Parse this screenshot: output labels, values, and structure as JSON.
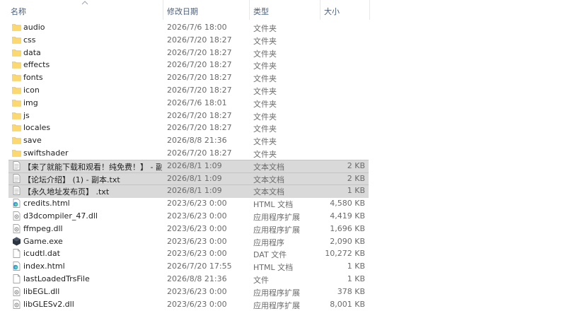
{
  "columns": {
    "name": "名称",
    "date": "修改日期",
    "type": "类型",
    "size": "大小"
  },
  "files": [
    {
      "name": "audio",
      "date": "2026/7/6 18:00",
      "type": "文件夹",
      "size": "",
      "icon": "folder-icon",
      "selected": false
    },
    {
      "name": "css",
      "date": "2026/7/20 18:27",
      "type": "文件夹",
      "size": "",
      "icon": "folder-icon",
      "selected": false
    },
    {
      "name": "data",
      "date": "2026/7/20 18:27",
      "type": "文件夹",
      "size": "",
      "icon": "folder-icon",
      "selected": false
    },
    {
      "name": "effects",
      "date": "2026/7/20 18:27",
      "type": "文件夹",
      "size": "",
      "icon": "folder-icon",
      "selected": false
    },
    {
      "name": "fonts",
      "date": "2026/7/20 18:27",
      "type": "文件夹",
      "size": "",
      "icon": "folder-icon",
      "selected": false
    },
    {
      "name": "icon",
      "date": "2026/7/20 18:27",
      "type": "文件夹",
      "size": "",
      "icon": "folder-icon",
      "selected": false
    },
    {
      "name": "img",
      "date": "2026/7/6 18:01",
      "type": "文件夹",
      "size": "",
      "icon": "folder-icon",
      "selected": false
    },
    {
      "name": "js",
      "date": "2026/7/20 18:27",
      "type": "文件夹",
      "size": "",
      "icon": "folder-icon",
      "selected": false
    },
    {
      "name": "locales",
      "date": "2026/7/20 18:27",
      "type": "文件夹",
      "size": "",
      "icon": "folder-icon",
      "selected": false
    },
    {
      "name": "save",
      "date": "2026/8/8 21:36",
      "type": "文件夹",
      "size": "",
      "icon": "folder-icon",
      "selected": false
    },
    {
      "name": "swiftshader",
      "date": "2026/7/20 18:27",
      "type": "文件夹",
      "size": "",
      "icon": "folder-icon",
      "selected": false
    },
    {
      "name": "【来了就能下载和观看！纯免费！】 - 副...",
      "date": "2026/8/1 1:09",
      "type": "文本文档",
      "size": "2 KB",
      "icon": "text-file-icon",
      "selected": true
    },
    {
      "name": "【论坛介绍】 (1) - 副本.txt",
      "date": "2026/8/1 1:09",
      "type": "文本文档",
      "size": "2 KB",
      "icon": "text-file-icon",
      "selected": true
    },
    {
      "name": "【永久地址发布页】 .txt",
      "date": "2026/8/1 1:09",
      "type": "文本文档",
      "size": "1 KB",
      "icon": "text-file-icon",
      "selected": true
    },
    {
      "name": "credits.html",
      "date": "2023/6/23 0:00",
      "type": "HTML 文档",
      "size": "4,580 KB",
      "icon": "edge-html-icon",
      "selected": false
    },
    {
      "name": "d3dcompiler_47.dll",
      "date": "2023/6/23 0:00",
      "type": "应用程序扩展",
      "size": "4,419 KB",
      "icon": "dll-file-icon",
      "selected": false
    },
    {
      "name": "ffmpeg.dll",
      "date": "2023/6/23 0:00",
      "type": "应用程序扩展",
      "size": "1,696 KB",
      "icon": "dll-file-icon",
      "selected": false
    },
    {
      "name": "Game.exe",
      "date": "2023/6/23 0:00",
      "type": "应用程序",
      "size": "2,090 KB",
      "icon": "game-exe-icon",
      "selected": false
    },
    {
      "name": "icudtl.dat",
      "date": "2023/6/23 0:00",
      "type": "DAT 文件",
      "size": "10,272 KB",
      "icon": "blank-file-icon",
      "selected": false
    },
    {
      "name": "index.html",
      "date": "2026/7/20 17:55",
      "type": "HTML 文档",
      "size": "1 KB",
      "icon": "edge-html-icon",
      "selected": false
    },
    {
      "name": "lastLoadedTrsFile",
      "date": "2026/8/8 21:36",
      "type": "文件",
      "size": "1 KB",
      "icon": "blank-file-icon",
      "selected": false
    },
    {
      "name": "libEGL.dll",
      "date": "2023/6/23 0:00",
      "type": "应用程序扩展",
      "size": "378 KB",
      "icon": "dll-file-icon",
      "selected": false
    },
    {
      "name": "libGLESv2.dll",
      "date": "2023/6/23 0:00",
      "type": "应用程序扩展",
      "size": "8,001 KB",
      "icon": "dll-file-icon",
      "selected": false
    }
  ]
}
